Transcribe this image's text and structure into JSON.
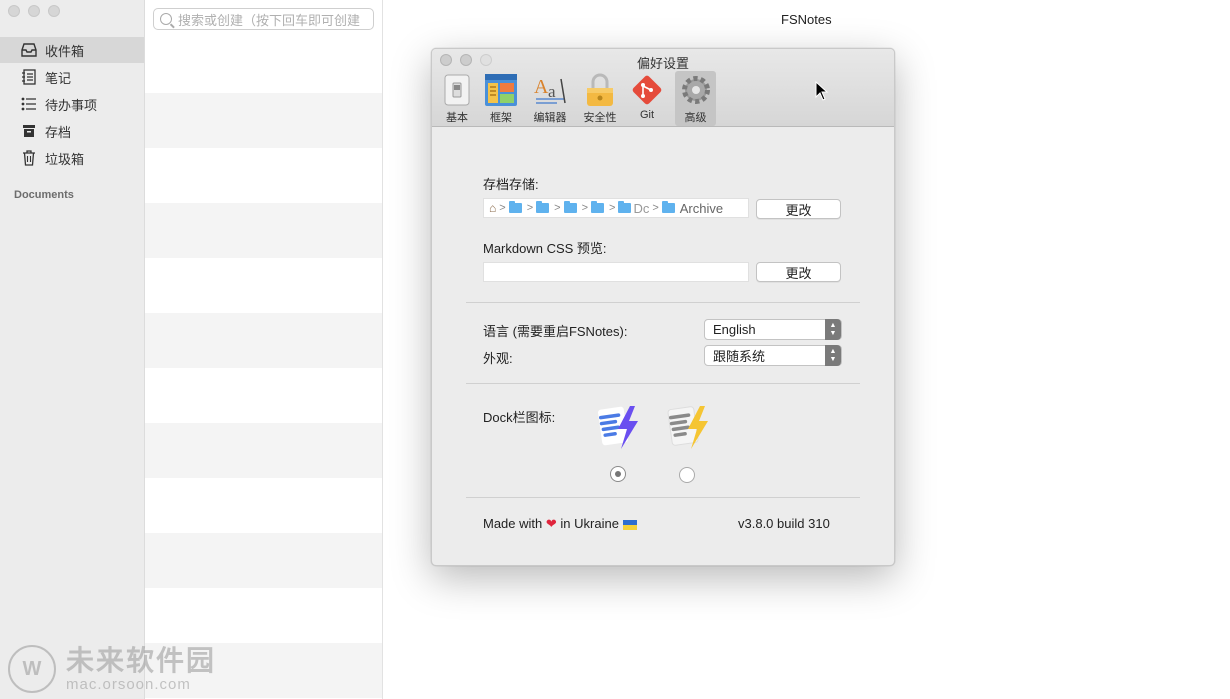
{
  "window": {
    "app_title": "FSNotes"
  },
  "sidebar": {
    "items": [
      {
        "label": "收件箱",
        "icon": "inbox-icon"
      },
      {
        "label": "笔记",
        "icon": "notebook-icon"
      },
      {
        "label": "待办事项",
        "icon": "checklist-icon"
      },
      {
        "label": "存档",
        "icon": "archive-icon"
      },
      {
        "label": "垃圾箱",
        "icon": "trash-icon"
      }
    ],
    "section_header": "Documents",
    "selected": "收件箱"
  },
  "search": {
    "placeholder": "搜索或创建（按下回车即可创建"
  },
  "preferences": {
    "title": "偏好设置",
    "toolbar": [
      {
        "label": "基本",
        "icon": "switch-icon"
      },
      {
        "label": "框架",
        "icon": "layout-icon"
      },
      {
        "label": "编辑器",
        "icon": "font-icon"
      },
      {
        "label": "安全性",
        "icon": "lock-icon"
      },
      {
        "label": "Git",
        "icon": "git-icon"
      },
      {
        "label": "高级",
        "icon": "gear-icon"
      }
    ],
    "active_tab": "高级",
    "archive_storage": {
      "label": "存档存储:",
      "path_trailing": "Dc",
      "path_last": "Archive",
      "change_label": "更改"
    },
    "markdown_css": {
      "label": "Markdown CSS 预览:",
      "value": "",
      "change_label": "更改"
    },
    "language": {
      "label": "语言 (需要重启FSNotes):",
      "value": "English"
    },
    "appearance": {
      "label": "外观:",
      "value": "跟随系统"
    },
    "dock_icon": {
      "label": "Dock栏图标:",
      "selected_index": 0
    },
    "footer": {
      "made_with_pre": "Made with",
      "made_with_post": "in Ukraine",
      "version": "v3.8.0 build 310"
    }
  },
  "watermark": {
    "cn": "未来软件园",
    "en": "mac.orsoon.com"
  },
  "colors": {
    "accent_git": "#e54b3b",
    "folder_blue": "#5fb2ee",
    "selection_gray": "#d7d7d7"
  }
}
